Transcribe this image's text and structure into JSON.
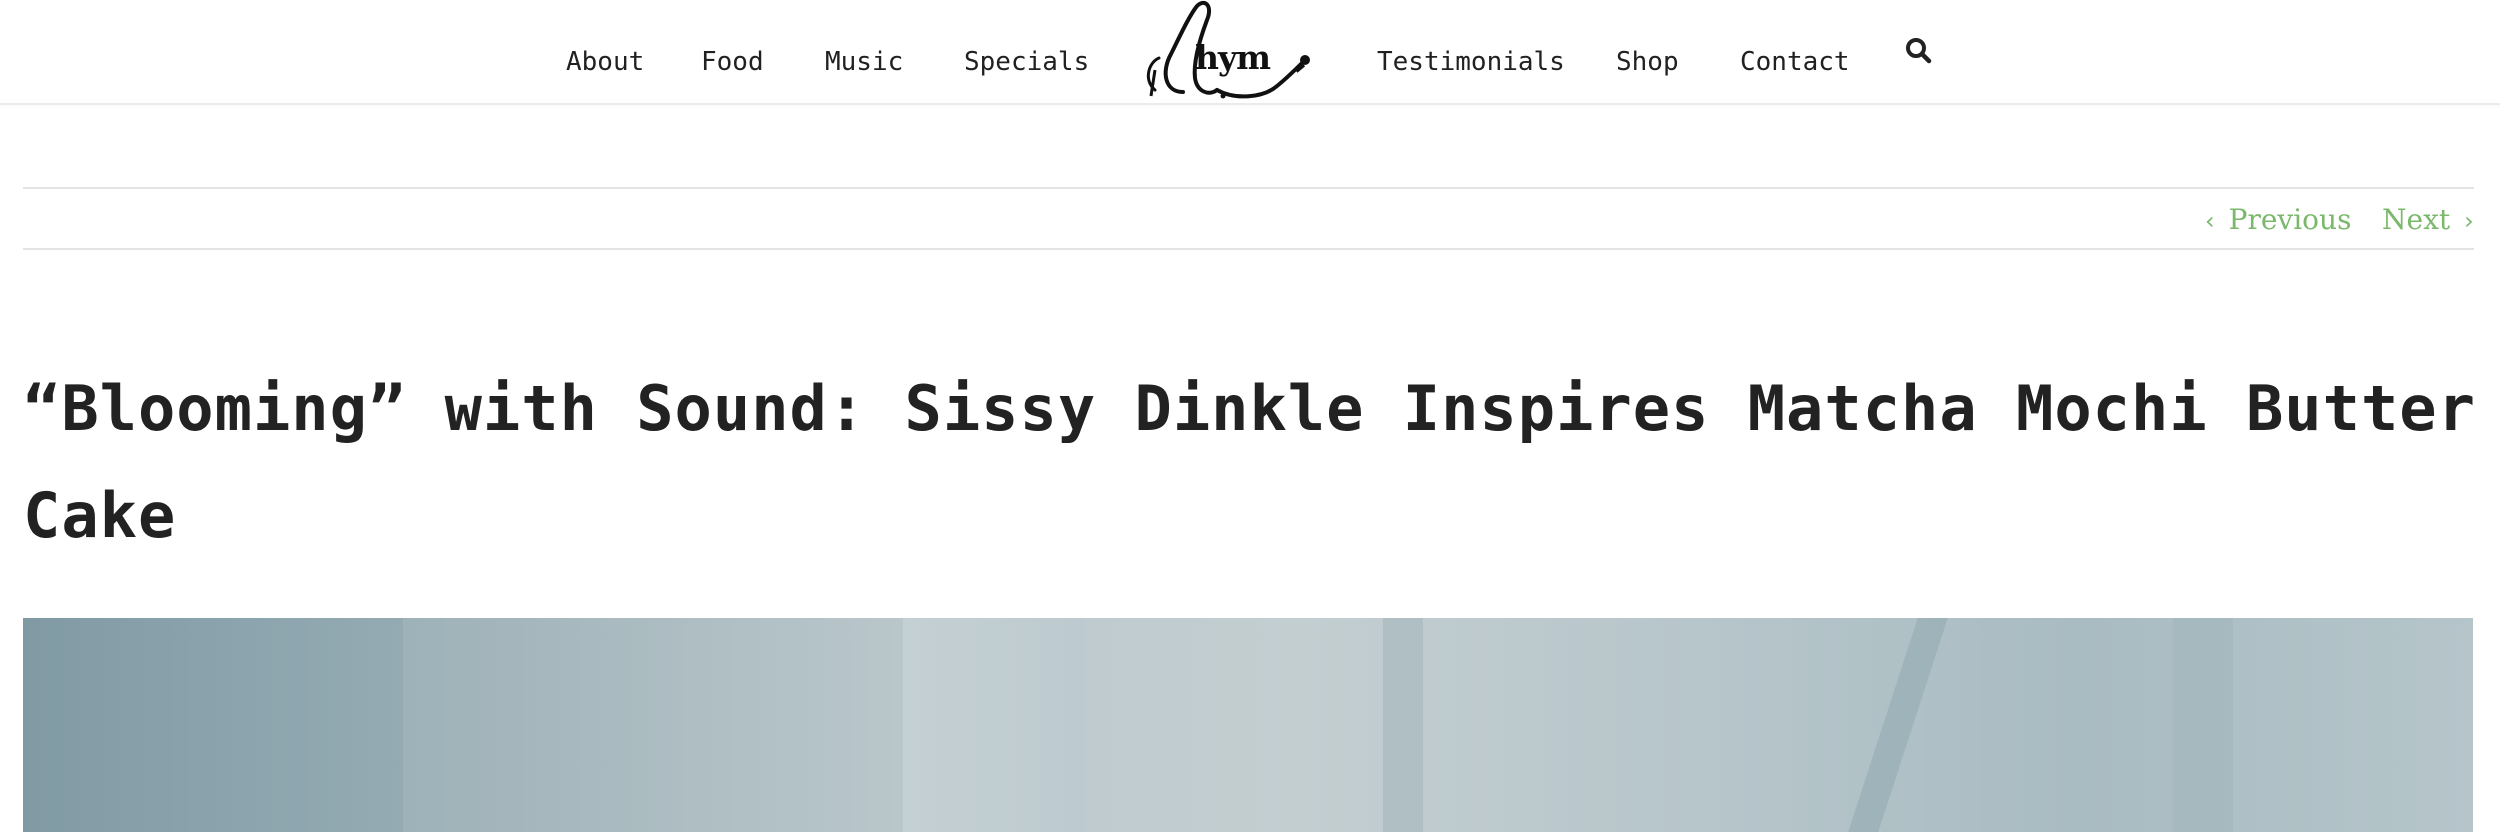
{
  "nav": {
    "left_items": [
      "About",
      "Food",
      "Music",
      "Specials"
    ],
    "right_items": [
      "Testimonials",
      "Shop",
      "Contact"
    ],
    "search_icon": "search-icon"
  },
  "logo": {
    "text": "hym"
  },
  "post_navigation": {
    "previous_label": "Previous",
    "next_label": "Next",
    "previous_icon": "chevron-left-icon",
    "next_icon": "chevron-right-icon"
  },
  "post": {
    "title": "“Blooming” with Sound: Sissy Dinkle Inspires Matcha Mochi Butter Cake"
  },
  "colors": {
    "accent": "#7ab86b",
    "text": "#222222",
    "rule": "#e4e4e4"
  }
}
